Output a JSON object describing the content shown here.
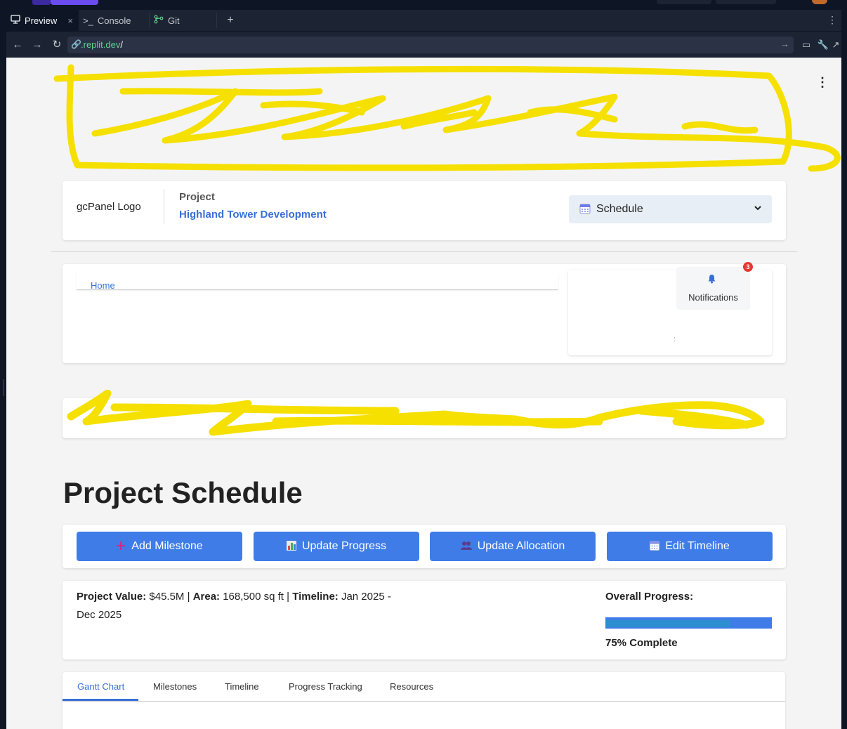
{
  "ide": {
    "tabs": [
      {
        "label": "Preview",
        "icon": "monitor-icon"
      },
      {
        "label": "Console",
        "icon": "terminal-icon"
      },
      {
        "label": "Git",
        "icon": "git-branch-icon"
      }
    ],
    "close_glyph": "×",
    "add_tab_glyph": "+",
    "url_host": ".replit.dev",
    "url_path": "/"
  },
  "header": {
    "logo_alt": "gcPanel Logo",
    "project_label": "Project",
    "project_name": "Highland Tower Development",
    "view_select": {
      "selected": "Schedule",
      "icon": "calendar-icon"
    }
  },
  "breadcrumb": {
    "home": "Home"
  },
  "notifications": {
    "label": "Notifications",
    "count": "3",
    "dot": ":"
  },
  "page": {
    "title": "Project Schedule",
    "actions": [
      {
        "label": "Add Milestone",
        "icon": "plus-icon",
        "glyph": "➕"
      },
      {
        "label": "Update Progress",
        "icon": "chart-icon",
        "glyph": "📊"
      },
      {
        "label": "Update Allocation",
        "icon": "people-icon",
        "glyph": "👥"
      },
      {
        "label": "Edit Timeline",
        "icon": "calendar-icon",
        "glyph": "📅"
      }
    ],
    "info": {
      "value_label": "Project Value:",
      "value": "$45.5M",
      "area_label": "Area:",
      "area": "168,500 sq ft",
      "timeline_label": "Timeline:",
      "timeline": "Jan 2025 - Dec 2025",
      "separator": "|"
    },
    "progress": {
      "label": "Overall Progress:",
      "percent": 75,
      "text": "75% Complete"
    },
    "tabs": [
      "Gantt Chart",
      "Milestones",
      "Timeline",
      "Progress Tracking",
      "Resources"
    ],
    "active_tab": "Gantt Chart"
  },
  "colors": {
    "accent": "#3f7ce8",
    "link": "#3a6fd8",
    "redaction": "#f5e000",
    "badge": "#e53935"
  }
}
